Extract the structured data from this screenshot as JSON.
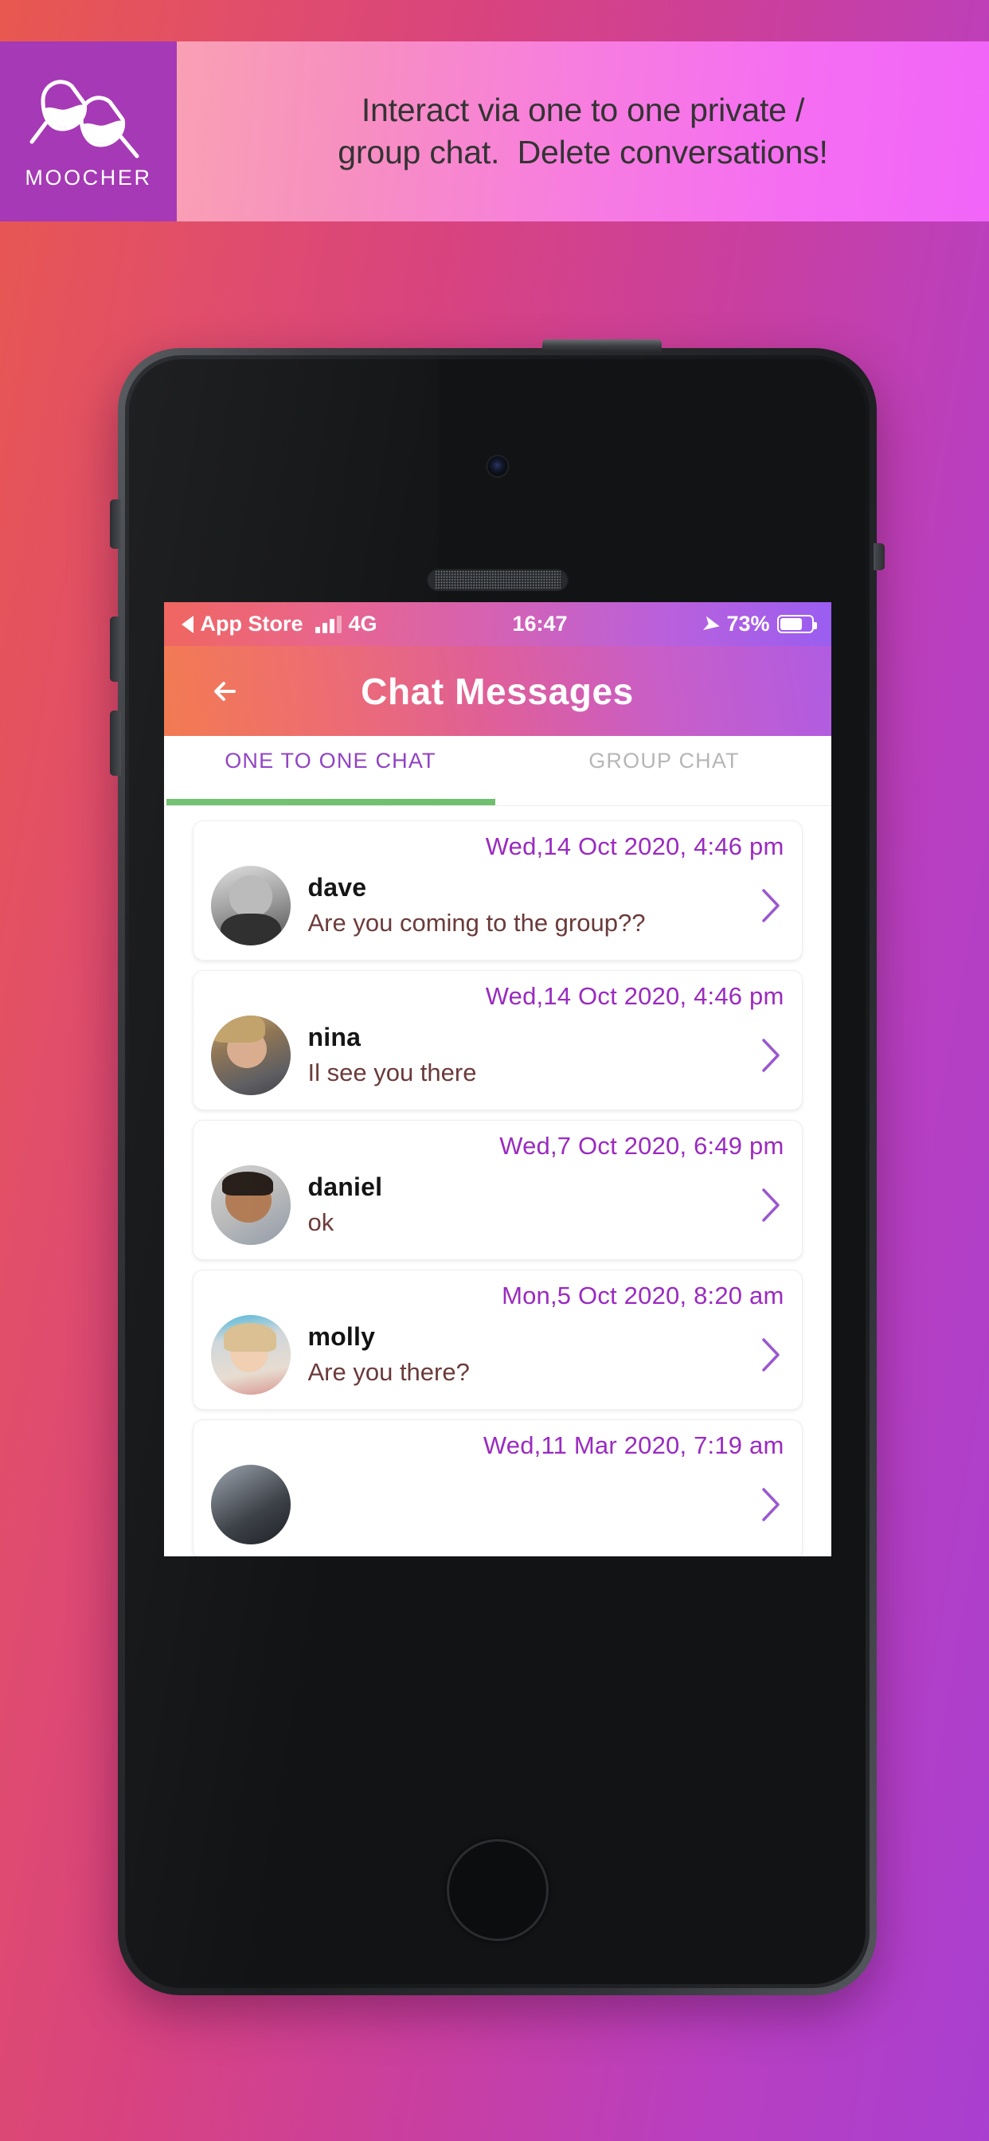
{
  "promo": {
    "logo_word": "MOOCHER",
    "logo_icon": "wine-glasses-icon",
    "line1": "Interact via one to one private /",
    "line2": "group chat.  Delete conversations!"
  },
  "phone": {
    "status_bar": {
      "back_label": "App Store",
      "network": "4G",
      "time": "16:47",
      "battery_percent": "73%",
      "location_icon": "location-arrow-icon",
      "signal_icon": "signal-bars-icon",
      "battery_icon": "battery-icon"
    },
    "app_bar": {
      "back_icon": "back-arrow-icon",
      "title": "Chat Messages"
    },
    "tabs": [
      {
        "label": "ONE TO ONE CHAT",
        "active": true
      },
      {
        "label": "GROUP CHAT",
        "active": false
      }
    ],
    "chats": [
      {
        "date": "Wed,14 Oct 2020, 4:46 pm",
        "name": "dave",
        "message": "Are you coming to the group??",
        "avatar": "avatar-dave",
        "chevron": "chevron-right-icon"
      },
      {
        "date": "Wed,14 Oct 2020, 4:46 pm",
        "name": "nina",
        "message": "Il see you there",
        "avatar": "avatar-nina",
        "chevron": "chevron-right-icon"
      },
      {
        "date": "Wed,7 Oct 2020, 6:49 pm",
        "name": "daniel",
        "message": "ok",
        "avatar": "avatar-daniel",
        "chevron": "chevron-right-icon"
      },
      {
        "date": "Mon,5 Oct 2020, 8:20 am",
        "name": "molly",
        "message": "Are you there?",
        "avatar": "avatar-molly",
        "chevron": "chevron-right-icon"
      },
      {
        "date": "Wed,11 Mar 2020, 7:19 am",
        "name": "",
        "message": "",
        "avatar": "avatar-unknown",
        "chevron": "chevron-right-icon"
      }
    ]
  },
  "colors": {
    "accent_purple": "#9a2bc0",
    "tab_active": "#8e3fc4",
    "tab_inactive": "#b6b6b6",
    "tab_underline_green": "#6ec06e",
    "message_text": "#6b3a3a",
    "logo_bg": "#a639b5",
    "promo_bg_start": "#f9a0b4",
    "promo_bg_end": "#f165f8",
    "bg_start": "#e8584f",
    "bg_end": "#a93fd0"
  }
}
